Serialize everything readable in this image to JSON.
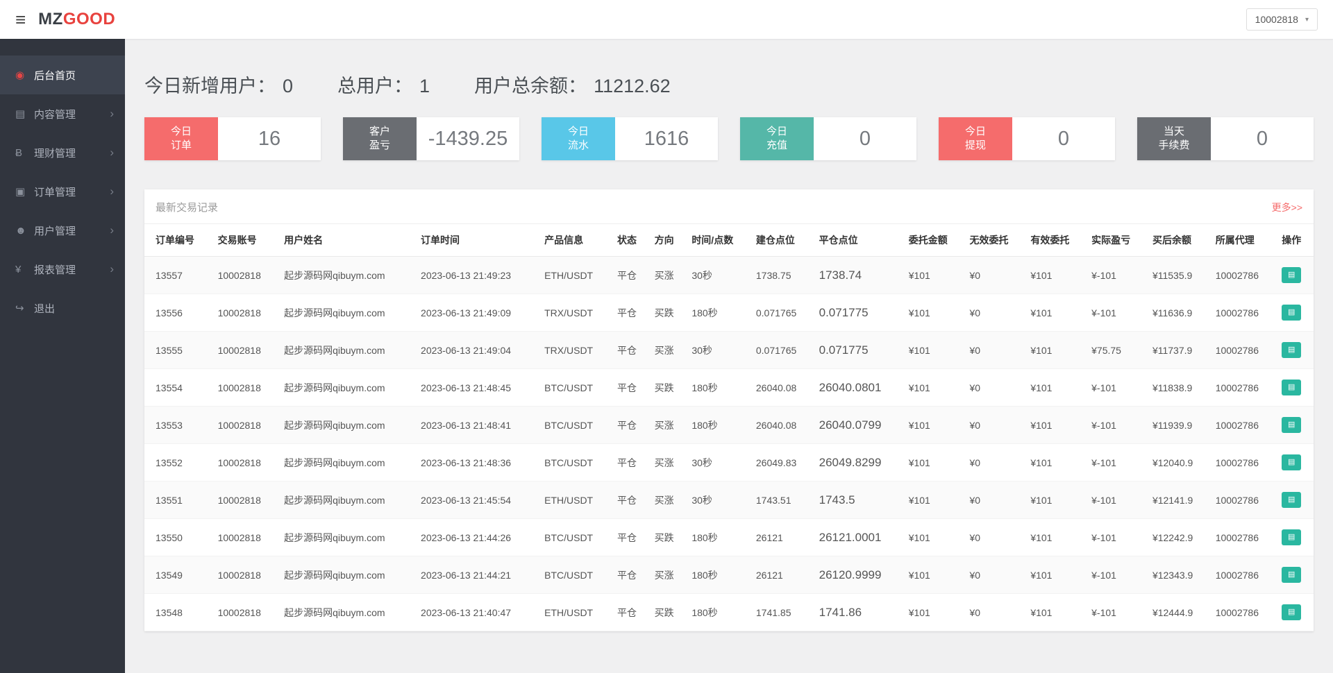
{
  "colors": {
    "red": "#e64545",
    "green": "#23a85f",
    "logo_red": "#e8423e",
    "sidebar_bg": "#31353e",
    "teal_button": "#2ab7a0",
    "more_link": "#f56c6c"
  },
  "topbar": {
    "logo_prefix": "MZ",
    "logo_suffix": "GOOD",
    "account": "10002818"
  },
  "sidebar": {
    "items": [
      {
        "id": "home",
        "icon": "dashboard",
        "label": "后台首页",
        "active": true,
        "arrow": false
      },
      {
        "id": "content",
        "icon": "content",
        "label": "内容管理",
        "active": false,
        "arrow": true
      },
      {
        "id": "finance",
        "icon": "finance",
        "label": "理财管理",
        "active": false,
        "arrow": true
      },
      {
        "id": "order",
        "icon": "order",
        "label": "订单管理",
        "active": false,
        "arrow": true
      },
      {
        "id": "user",
        "icon": "user",
        "label": "用户管理",
        "active": false,
        "arrow": true
      },
      {
        "id": "report",
        "icon": "report",
        "label": "报表管理",
        "active": false,
        "arrow": true
      },
      {
        "id": "logout",
        "icon": "logout",
        "label": "退出",
        "active": false,
        "arrow": false
      }
    ]
  },
  "summary": [
    {
      "id": "new-users",
      "label": "今日新增用户：",
      "value": "0"
    },
    {
      "id": "total-users",
      "label": "总用户：",
      "value": "1"
    },
    {
      "id": "total-balance",
      "label": "用户总余额：",
      "value": "11212.62"
    }
  ],
  "cards": [
    {
      "id": "today-orders",
      "lines": [
        "今日",
        "订单"
      ],
      "value": "16",
      "color": "#f56c6c"
    },
    {
      "id": "customer-pl",
      "lines": [
        "客户",
        "盈亏"
      ],
      "value": "-1439.25",
      "color": "#6a6d72"
    },
    {
      "id": "today-flow",
      "lines": [
        "今日",
        "流水"
      ],
      "value": "1616",
      "color": "#59c7e8"
    },
    {
      "id": "today-deposit",
      "lines": [
        "今日",
        "充值"
      ],
      "value": "0",
      "color": "#55b7a8"
    },
    {
      "id": "today-withdraw",
      "lines": [
        "今日",
        "提现"
      ],
      "value": "0",
      "color": "#f56c6c"
    },
    {
      "id": "today-fee",
      "lines": [
        "当天",
        "手续费"
      ],
      "value": "0",
      "color": "#6a6d72"
    }
  ],
  "table": {
    "title": "最新交易记录",
    "more_label": "更多>>",
    "headers": [
      "订单编号",
      "交易账号",
      "用户姓名",
      "订单时间",
      "产品信息",
      "状态",
      "方向",
      "时间/点数",
      "建仓点位",
      "平仓点位",
      "委托金额",
      "无效委托",
      "有效委托",
      "实际盈亏",
      "买后余额",
      "所属代理",
      "操作"
    ],
    "rows": [
      {
        "order_id": "13557",
        "account": "10002818",
        "username": "起步源码网qibuym.com",
        "time": "2023-06-13 21:49:23",
        "product": "ETH/USDT",
        "status": "平仓",
        "direction": "买涨",
        "direction_color": "red",
        "duration": "30秒",
        "open_price": "1738.75",
        "close_price": "1738.74",
        "close_color": "green",
        "entrust": "¥101",
        "invalid": "¥0",
        "valid": "¥101",
        "profit": "¥-101",
        "profit_color": "green",
        "balance": "¥11535.9",
        "agent": "10002786"
      },
      {
        "order_id": "13556",
        "account": "10002818",
        "username": "起步源码网qibuym.com",
        "time": "2023-06-13 21:49:09",
        "product": "TRX/USDT",
        "status": "平仓",
        "direction": "买跌",
        "direction_color": "green",
        "duration": "180秒",
        "open_price": "0.071765",
        "close_price": "0.071775",
        "close_color": "red",
        "entrust": "¥101",
        "invalid": "¥0",
        "valid": "¥101",
        "profit": "¥-101",
        "profit_color": "green",
        "balance": "¥11636.9",
        "agent": "10002786"
      },
      {
        "order_id": "13555",
        "account": "10002818",
        "username": "起步源码网qibuym.com",
        "time": "2023-06-13 21:49:04",
        "product": "TRX/USDT",
        "status": "平仓",
        "direction": "买涨",
        "direction_color": "red",
        "duration": "30秒",
        "open_price": "0.071765",
        "close_price": "0.071775",
        "close_color": "red",
        "entrust": "¥101",
        "invalid": "¥0",
        "valid": "¥101",
        "profit": "¥75.75",
        "profit_color": "red",
        "balance": "¥11737.9",
        "agent": "10002786"
      },
      {
        "order_id": "13554",
        "account": "10002818",
        "username": "起步源码网qibuym.com",
        "time": "2023-06-13 21:48:45",
        "product": "BTC/USDT",
        "status": "平仓",
        "direction": "买跌",
        "direction_color": "green",
        "duration": "180秒",
        "open_price": "26040.08",
        "close_price": "26040.0801",
        "close_color": "red",
        "entrust": "¥101",
        "invalid": "¥0",
        "valid": "¥101",
        "profit": "¥-101",
        "profit_color": "green",
        "balance": "¥11838.9",
        "agent": "10002786"
      },
      {
        "order_id": "13553",
        "account": "10002818",
        "username": "起步源码网qibuym.com",
        "time": "2023-06-13 21:48:41",
        "product": "BTC/USDT",
        "status": "平仓",
        "direction": "买涨",
        "direction_color": "red",
        "duration": "180秒",
        "open_price": "26040.08",
        "close_price": "26040.0799",
        "close_color": "green",
        "entrust": "¥101",
        "invalid": "¥0",
        "valid": "¥101",
        "profit": "¥-101",
        "profit_color": "green",
        "balance": "¥11939.9",
        "agent": "10002786"
      },
      {
        "order_id": "13552",
        "account": "10002818",
        "username": "起步源码网qibuym.com",
        "time": "2023-06-13 21:48:36",
        "product": "BTC/USDT",
        "status": "平仓",
        "direction": "买涨",
        "direction_color": "red",
        "duration": "30秒",
        "open_price": "26049.83",
        "close_price": "26049.8299",
        "close_color": "green",
        "entrust": "¥101",
        "invalid": "¥0",
        "valid": "¥101",
        "profit": "¥-101",
        "profit_color": "green",
        "balance": "¥12040.9",
        "agent": "10002786"
      },
      {
        "order_id": "13551",
        "account": "10002818",
        "username": "起步源码网qibuym.com",
        "time": "2023-06-13 21:45:54",
        "product": "ETH/USDT",
        "status": "平仓",
        "direction": "买涨",
        "direction_color": "red",
        "duration": "30秒",
        "open_price": "1743.51",
        "close_price": "1743.5",
        "close_color": "green",
        "entrust": "¥101",
        "invalid": "¥0",
        "valid": "¥101",
        "profit": "¥-101",
        "profit_color": "green",
        "balance": "¥12141.9",
        "agent": "10002786"
      },
      {
        "order_id": "13550",
        "account": "10002818",
        "username": "起步源码网qibuym.com",
        "time": "2023-06-13 21:44:26",
        "product": "BTC/USDT",
        "status": "平仓",
        "direction": "买跌",
        "direction_color": "green",
        "duration": "180秒",
        "open_price": "26121",
        "close_price": "26121.0001",
        "close_color": "red",
        "entrust": "¥101",
        "invalid": "¥0",
        "valid": "¥101",
        "profit": "¥-101",
        "profit_color": "green",
        "balance": "¥12242.9",
        "agent": "10002786"
      },
      {
        "order_id": "13549",
        "account": "10002818",
        "username": "起步源码网qibuym.com",
        "time": "2023-06-13 21:44:21",
        "product": "BTC/USDT",
        "status": "平仓",
        "direction": "买涨",
        "direction_color": "red",
        "duration": "180秒",
        "open_price": "26121",
        "close_price": "26120.9999",
        "close_color": "green",
        "entrust": "¥101",
        "invalid": "¥0",
        "valid": "¥101",
        "profit": "¥-101",
        "profit_color": "green",
        "balance": "¥12343.9",
        "agent": "10002786"
      },
      {
        "order_id": "13548",
        "account": "10002818",
        "username": "起步源码网qibuym.com",
        "time": "2023-06-13 21:40:47",
        "product": "ETH/USDT",
        "status": "平仓",
        "direction": "买跌",
        "direction_color": "green",
        "duration": "180秒",
        "open_price": "1741.85",
        "close_price": "1741.86",
        "close_color": "red",
        "entrust": "¥101",
        "invalid": "¥0",
        "valid": "¥101",
        "profit": "¥-101",
        "profit_color": "green",
        "balance": "¥12444.9",
        "agent": "10002786"
      }
    ]
  }
}
